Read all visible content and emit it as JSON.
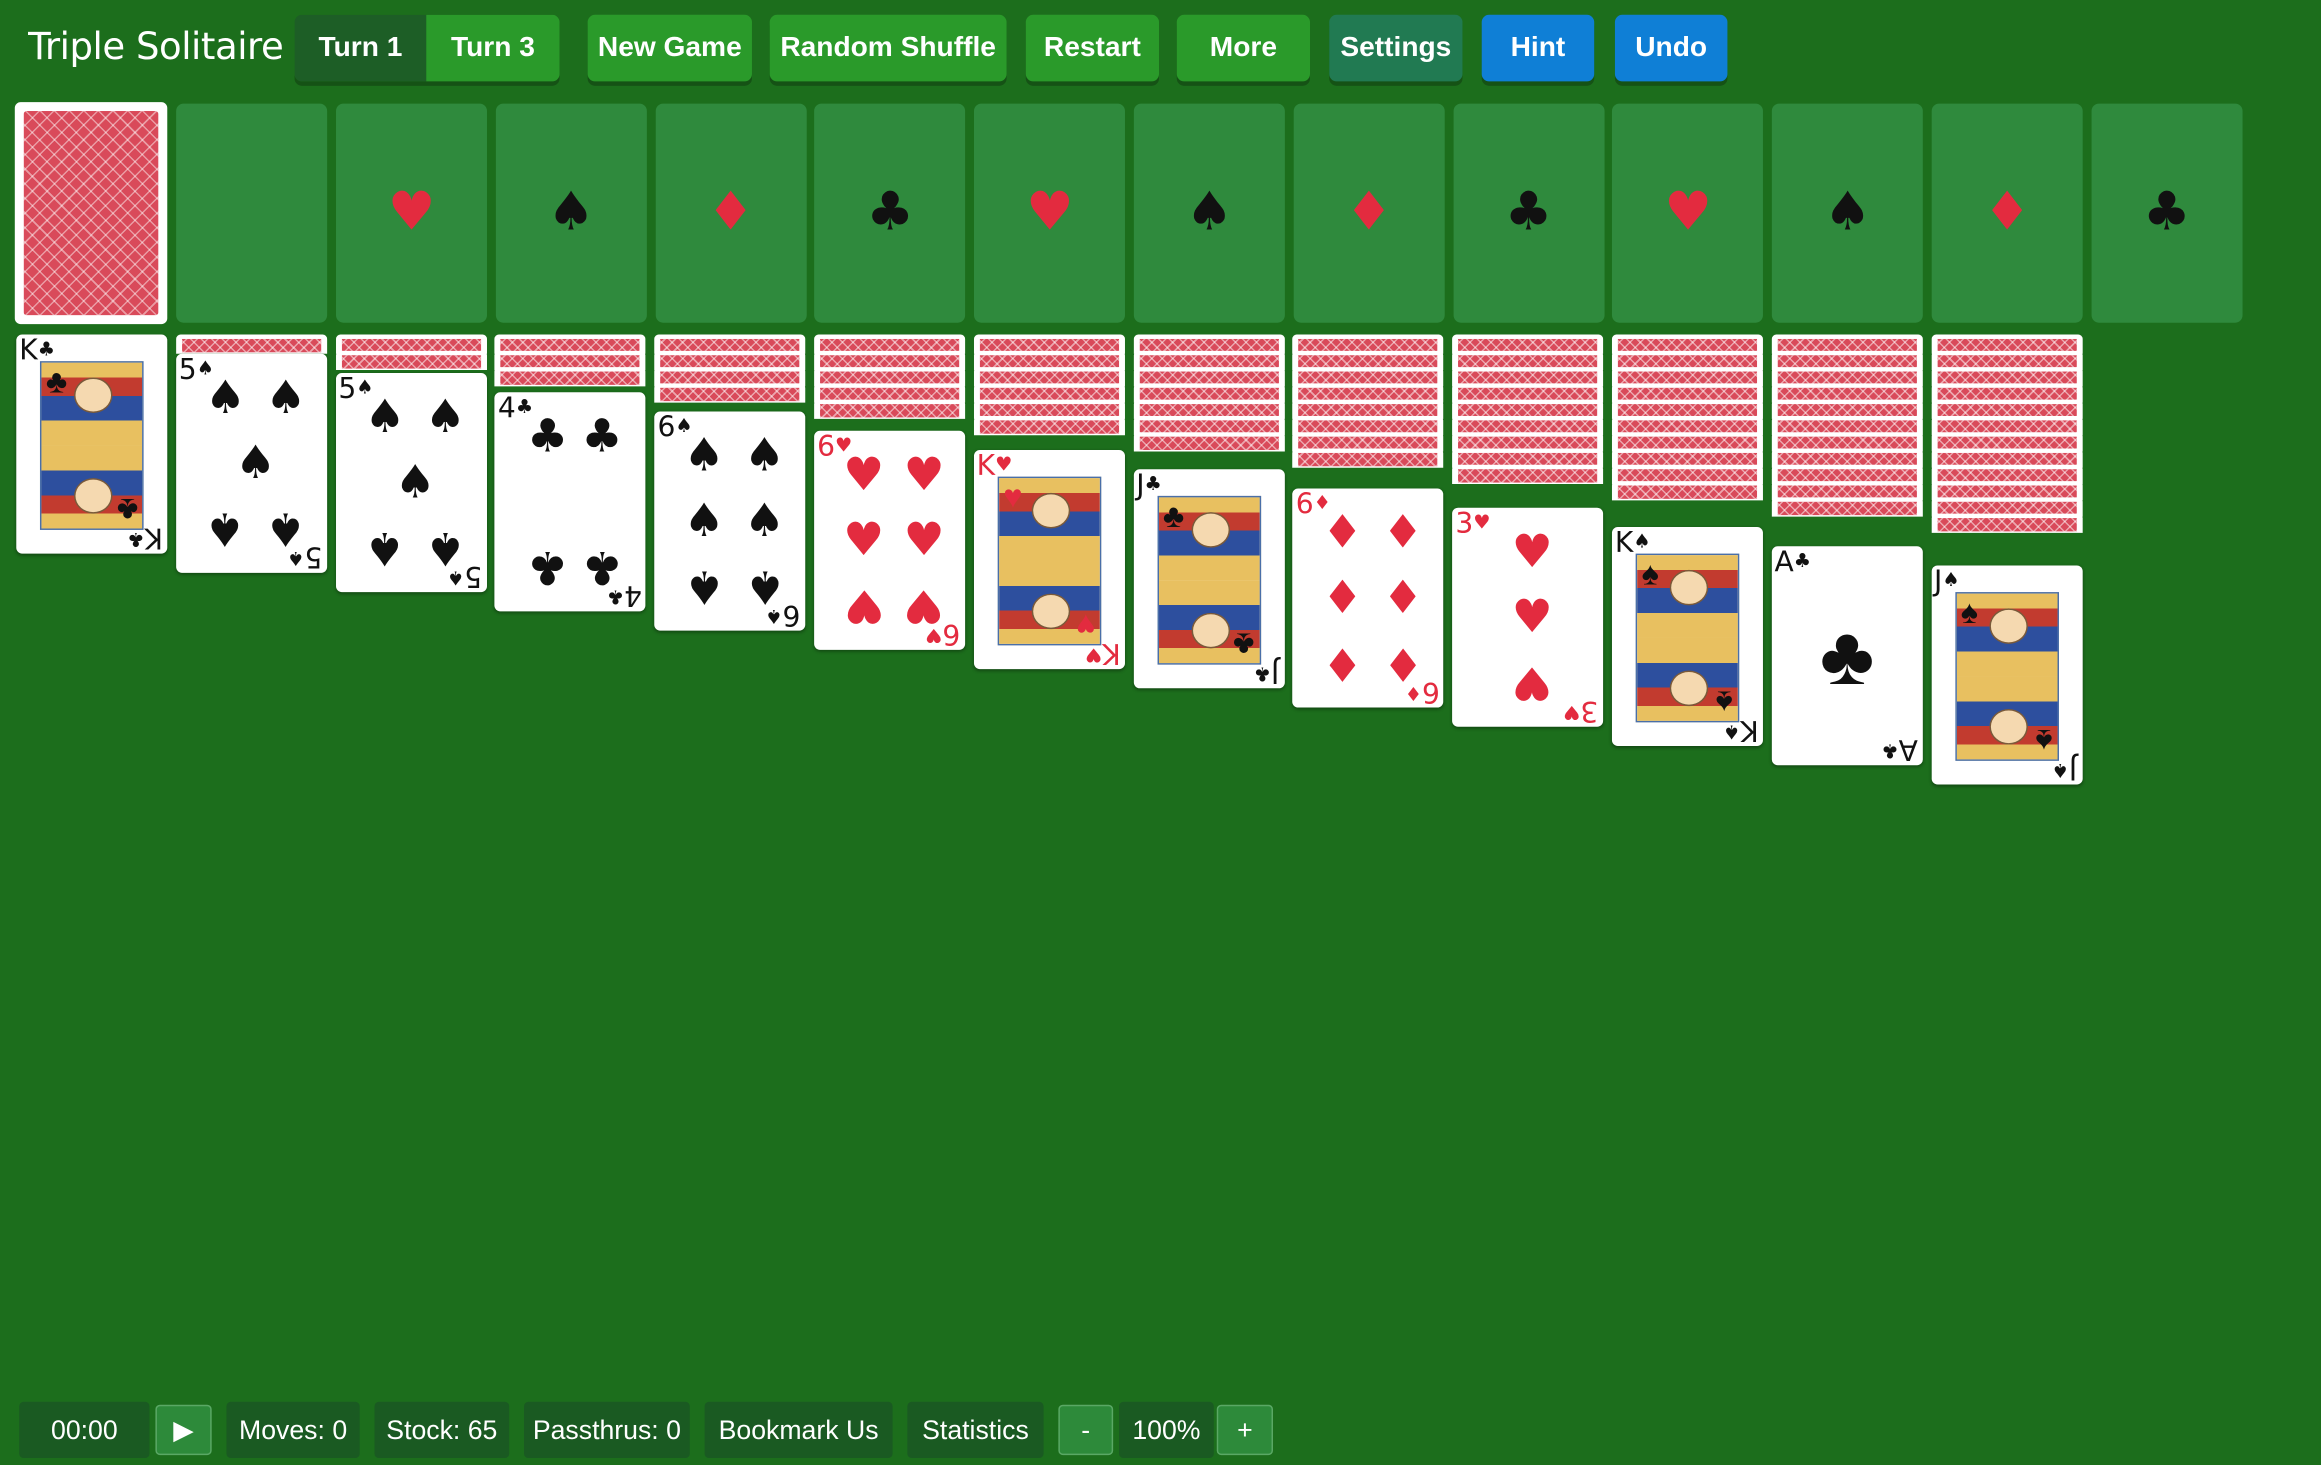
{
  "app": {
    "title": "Triple Solitaire"
  },
  "toolbar": {
    "turn1": "Turn 1",
    "turn3": "Turn 3",
    "new_game": "New Game",
    "random_shuffle": "Random Shuffle",
    "restart": "Restart",
    "more": "More",
    "settings": "Settings",
    "hint": "Hint",
    "undo": "Undo"
  },
  "foundations": [
    {
      "suit": "♥",
      "color": "red"
    },
    {
      "suit": "♠",
      "color": "black"
    },
    {
      "suit": "♦",
      "color": "red"
    },
    {
      "suit": "♣",
      "color": "black"
    },
    {
      "suit": "♥",
      "color": "red"
    },
    {
      "suit": "♠",
      "color": "black"
    },
    {
      "suit": "♦",
      "color": "red"
    },
    {
      "suit": "♣",
      "color": "black"
    },
    {
      "suit": "♥",
      "color": "red"
    },
    {
      "suit": "♠",
      "color": "black"
    },
    {
      "suit": "♦",
      "color": "red"
    },
    {
      "suit": "♣",
      "color": "black"
    }
  ],
  "tableau": [
    {
      "rank": "K",
      "suit": "♣",
      "hidden": 0
    },
    {
      "rank": "5",
      "suit": "♠",
      "hidden": 1
    },
    {
      "rank": "5",
      "suit": "♠",
      "hidden": 2
    },
    {
      "rank": "4",
      "suit": "♣",
      "hidden": 3
    },
    {
      "rank": "6",
      "suit": "♠",
      "hidden": 4
    },
    {
      "rank": "6",
      "suit": "♥",
      "hidden": 5
    },
    {
      "rank": "K",
      "suit": "♥",
      "hidden": 6
    },
    {
      "rank": "J",
      "suit": "♣",
      "hidden": 7
    },
    {
      "rank": "6",
      "suit": "♦",
      "hidden": 8
    },
    {
      "rank": "3",
      "suit": "♥",
      "hidden": 9
    },
    {
      "rank": "K",
      "suit": "♠",
      "hidden": 10
    },
    {
      "rank": "A",
      "suit": "♣",
      "hidden": 11
    },
    {
      "rank": "J",
      "suit": "♠",
      "hidden": 12
    }
  ],
  "status": {
    "timer": "00:00",
    "play": "▶",
    "moves": "Moves: 0",
    "stock": "Stock: 65",
    "passthrus": "Passthrus: 0",
    "bookmark": "Bookmark Us",
    "statistics": "Statistics",
    "zoom_out": "-",
    "zoom": "100%",
    "zoom_in": "+"
  },
  "colors": {
    "felt": "#1c6e1c",
    "red": "#e32b3f",
    "black": "#111111",
    "button": "#2a9a2a",
    "hint": "#0f7fd6"
  }
}
